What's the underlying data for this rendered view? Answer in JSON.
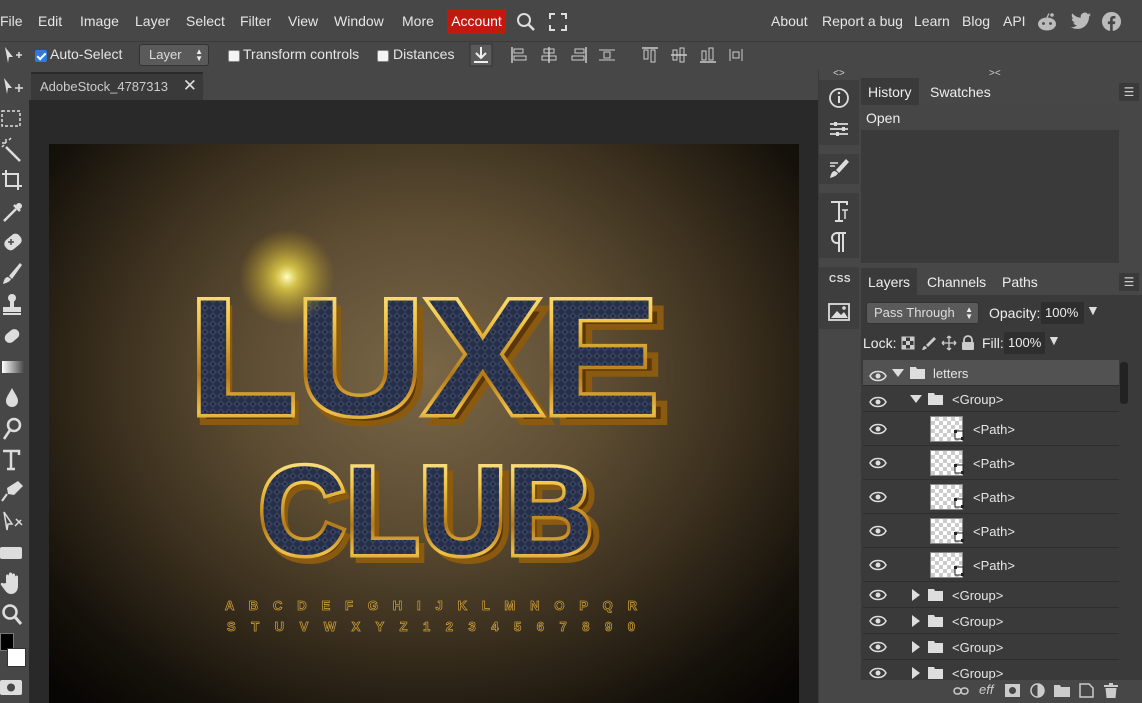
{
  "menu": {
    "items": [
      "File",
      "Edit",
      "Image",
      "Layer",
      "Select",
      "Filter",
      "View",
      "Window",
      "More"
    ],
    "account": "Account",
    "right_links": [
      "About",
      "Report a bug",
      "Learn",
      "Blog",
      "API"
    ]
  },
  "options": {
    "auto_select_label": "Auto-Select",
    "auto_select_checked": true,
    "layer_select_value": "Layer",
    "transform_label": "Transform controls",
    "distances_label": "Distances"
  },
  "document": {
    "tab_name": "AdobeStock_4787313"
  },
  "artwork": {
    "line1": "LUXE",
    "line2": "CLUB",
    "alphabet_row1": "A B C D E F G H I J K L M N O P Q R",
    "alphabet_row2": "S T U V W X Y Z 1 2 3 4 5 6 7 8 9 0"
  },
  "icon_column": {
    "top_arrows": "<>",
    "css_label": "CSS"
  },
  "history_panel": {
    "tabs": [
      "History",
      "Swatches"
    ],
    "collapse": "><",
    "items": [
      "Open"
    ]
  },
  "layers_panel": {
    "tabs": [
      "Layers",
      "Channels",
      "Paths"
    ],
    "blend_mode": "Pass Through",
    "opacity_label": "Opacity:",
    "opacity_value": "100%",
    "lock_label": "Lock:",
    "fill_label": "Fill:",
    "fill_value": "100%",
    "layers": [
      {
        "name": "letters",
        "type": "folder",
        "expanded": true,
        "indent": 0
      },
      {
        "name": "<Group>",
        "type": "folder",
        "expanded": true,
        "indent": 1
      },
      {
        "name": "<Path>",
        "type": "path",
        "indent": 2
      },
      {
        "name": "<Path>",
        "type": "path",
        "indent": 2
      },
      {
        "name": "<Path>",
        "type": "path",
        "indent": 2
      },
      {
        "name": "<Path>",
        "type": "path",
        "indent": 2
      },
      {
        "name": "<Path>",
        "type": "path",
        "indent": 2
      },
      {
        "name": "<Group>",
        "type": "folder",
        "expanded": false,
        "indent": 1
      },
      {
        "name": "<Group>",
        "type": "folder",
        "expanded": false,
        "indent": 1
      },
      {
        "name": "<Group>",
        "type": "folder",
        "expanded": false,
        "indent": 1
      },
      {
        "name": "<Group>",
        "type": "folder",
        "expanded": false,
        "indent": 1
      }
    ]
  },
  "colors": {
    "accent_red": "#c2190f",
    "checkbox_blue": "#2f7bd9",
    "gold": "#e8b93a"
  }
}
